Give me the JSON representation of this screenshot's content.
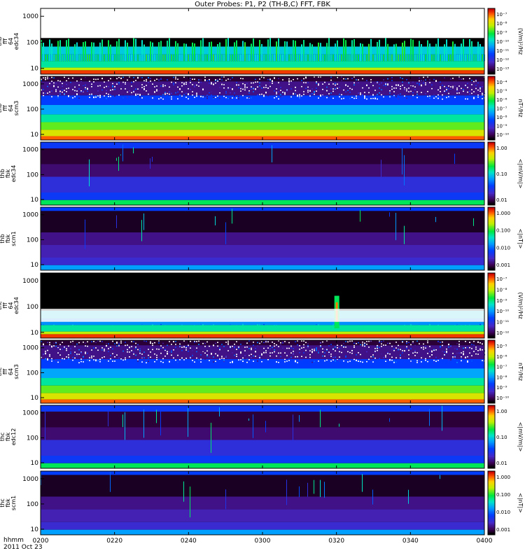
{
  "title": "Outer Probes: P1, P2 (TH-B,C) FFT, FBK",
  "time_axis": {
    "unit_label": "hhmm",
    "date_label": "2011 Oct 23",
    "ticks": [
      "0200",
      "0220",
      "0240",
      "0300",
      "0320",
      "0340",
      "0400"
    ]
  },
  "colors": {
    "background": "#000000",
    "frame": "#000000"
  },
  "chart_data": [
    {
      "type": "heatmap",
      "ylabel": [
        "thb",
        "fff",
        "64",
        "edc34"
      ],
      "yticks": [
        "10",
        "100",
        "1000"
      ],
      "yscale": "log",
      "colorbar": {
        "label": "(V/m)²/Hz",
        "ticks": [
          "10⁻⁷",
          "10⁻⁸",
          "10⁻⁹",
          "10⁻¹⁰",
          "10⁻¹¹",
          "10⁻¹²",
          "10⁻¹³"
        ]
      }
    },
    {
      "type": "heatmap",
      "ylabel": [
        "thb",
        "fff",
        "64",
        "scm3"
      ],
      "yticks": [
        "10",
        "100",
        "1000"
      ],
      "yscale": "log",
      "colorbar": {
        "label": "nT²/Hz",
        "ticks": [
          "10⁻⁴",
          "10⁻⁵",
          "10⁻⁶",
          "10⁻⁷",
          "10⁻⁸",
          "10⁻⁹",
          "10⁻¹⁰"
        ]
      }
    },
    {
      "type": "heatmap",
      "ylabel": [
        "thb",
        "fbk",
        "edc34"
      ],
      "yticks": [
        "10",
        "100",
        "1000"
      ],
      "yscale": "log",
      "colorbar": {
        "label": "<|mV/m|>",
        "ticks": [
          "1.00",
          "0.10",
          "0.01"
        ]
      }
    },
    {
      "type": "heatmap",
      "ylabel": [
        "thb",
        "fbk",
        "scm1"
      ],
      "yticks": [
        "10",
        "100",
        "1000"
      ],
      "yscale": "log",
      "colorbar": {
        "label": "<|nT|>",
        "ticks": [
          "1.000",
          "0.100",
          "0.010",
          "0.001"
        ]
      }
    },
    {
      "type": "heatmap",
      "ylabel": [
        "thc",
        "fff",
        "64",
        "edc34"
      ],
      "yticks": [
        "10",
        "100",
        "1000"
      ],
      "yscale": "log",
      "colorbar": {
        "label": "(V/m)²/Hz",
        "ticks": [
          "10⁻⁷",
          "10⁻⁸",
          "10⁻⁹",
          "10⁻¹⁰",
          "10⁻¹¹",
          "10⁻¹²"
        ]
      }
    },
    {
      "type": "heatmap",
      "ylabel": [
        "thc",
        "fff",
        "64",
        "scm3"
      ],
      "yticks": [
        "10",
        "100",
        "1000"
      ],
      "yscale": "log",
      "colorbar": {
        "label": "nT²/Hz",
        "ticks": [
          "10⁻⁵",
          "10⁻⁶",
          "10⁻⁷",
          "10⁻⁸",
          "10⁻⁹",
          "10⁻¹⁰"
        ]
      }
    },
    {
      "type": "heatmap",
      "ylabel": [
        "thc",
        "fbk",
        "edc12"
      ],
      "yticks": [
        "10",
        "100",
        "1000"
      ],
      "yscale": "log",
      "colorbar": {
        "label": "<|mV/m|>",
        "ticks": [
          "1.00",
          "0.10",
          "0.01"
        ]
      }
    },
    {
      "type": "heatmap",
      "ylabel": [
        "thc",
        "fbk",
        "scm1"
      ],
      "yticks": [
        "10",
        "100",
        "1000"
      ],
      "yscale": "log",
      "colorbar": {
        "label": "<|nT|>",
        "ticks": [
          "1.000",
          "0.100",
          "0.010",
          "0.001"
        ]
      }
    }
  ]
}
